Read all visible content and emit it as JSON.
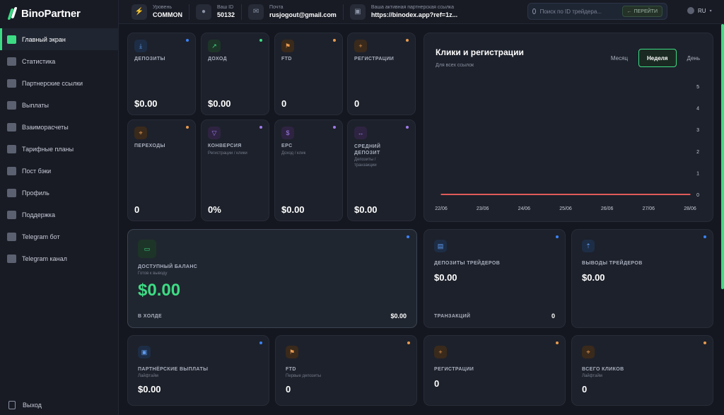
{
  "app": {
    "name": "BinoPartner"
  },
  "sidebar": {
    "items": [
      {
        "label": "Главный экран",
        "icon": "home-icon",
        "active": true
      },
      {
        "label": "Статистика",
        "icon": "stats-icon"
      },
      {
        "label": "Партнерские ссылки",
        "icon": "link-icon"
      },
      {
        "label": "Выплаты",
        "icon": "payout-icon"
      },
      {
        "label": "Взаиморасчеты",
        "icon": "settlement-icon"
      },
      {
        "label": "Тарифные планы",
        "icon": "tariff-icon"
      },
      {
        "label": "Пост бэки",
        "icon": "postback-icon"
      },
      {
        "label": "Профиль",
        "icon": "profile-icon"
      },
      {
        "label": "Поддержка",
        "icon": "support-icon"
      },
      {
        "label": "Telegram бот",
        "icon": "telegram-icon"
      },
      {
        "label": "Telegram канал",
        "icon": "telegram-icon"
      }
    ],
    "logout": "Выход"
  },
  "header": {
    "level_label": "Уровень",
    "level_value": "COMMON",
    "id_label": "Ваш ID",
    "id_value": "50132",
    "email_label": "Почта",
    "email_value": "rusjogout@gmail.com",
    "link_label": "Ваша активная партнерская ссылка",
    "link_value": "https://binodex.app?ref=1z...",
    "search_placeholder": "Поиск по ID трейдера...",
    "go_label": "ПЕРЕЙТИ",
    "lang": "RU"
  },
  "stats": {
    "deposits": {
      "title": "ДЕПОЗИТЫ",
      "value": "$0.00"
    },
    "income": {
      "title": "ДОХОД",
      "value": "$0.00"
    },
    "ftd": {
      "title": "FTD",
      "value": "0"
    },
    "registrations": {
      "title": "РЕГИСТРАЦИИ",
      "value": "0"
    },
    "transitions": {
      "title": "ПЕРЕХОДЫ",
      "value": "0"
    },
    "conversion": {
      "title": "КОНВЕРСИЯ",
      "sub": "Регистрации / клики",
      "value": "0%"
    },
    "epc": {
      "title": "EPC",
      "sub": "Доход / клик",
      "value": "$0.00"
    },
    "avg_deposit": {
      "title": "СРЕДНИЙ ДЕПОЗИТ",
      "sub": "Депозиты / транзакции",
      "value": "$0.00"
    }
  },
  "chart_card": {
    "title": "Клики и регистрации",
    "subtitle": "Для всех ссылок",
    "periods": [
      "Месяц",
      "Неделя",
      "День"
    ],
    "active_period": "Неделя"
  },
  "chart_data": {
    "type": "line",
    "x": [
      "22/06",
      "23/06",
      "24/06",
      "25/06",
      "26/06",
      "27/06",
      "28/06"
    ],
    "series": [
      {
        "values": [
          0,
          0,
          0,
          0,
          0,
          0,
          0
        ],
        "color": "#e05a5a"
      }
    ],
    "ylim": [
      0,
      5
    ],
    "yticks": [
      0,
      1,
      2,
      3,
      4,
      5
    ],
    "grid": false
  },
  "balance": {
    "title": "ДОСТУПНЫЙ БАЛАНС",
    "sub": "Готов к выводу",
    "value": "$0.00",
    "hold_label": "В ХОЛДЕ",
    "hold_value": "$0.00"
  },
  "trader_deposits": {
    "title": "ДЕПОЗИТЫ ТРЕЙДЕРОВ",
    "value": "$0.00",
    "tx_label": "ТРАНЗАКЦИЙ",
    "tx_value": "0"
  },
  "trader_withdrawals": {
    "title": "ВЫВОДЫ ТРЕЙДЕРОВ",
    "value": "$0.00"
  },
  "bottom": {
    "partner_payouts": {
      "title": "ПАРТНЁРСКИЕ ВЫПЛАТЫ",
      "sub": "Лайфтайм",
      "value": "$0.00"
    },
    "ftd": {
      "title": "FTD",
      "sub": "Первые депозиты",
      "value": "0"
    },
    "registrations": {
      "title": "РЕГИСТРАЦИИ",
      "value": "0"
    },
    "total_clicks": {
      "title": "ВСЕГО КЛИКОВ",
      "sub": "Лайфтайм",
      "value": "0"
    }
  },
  "colors": {
    "accent": "#3ddc84",
    "chart_line": "#e05a5a"
  }
}
